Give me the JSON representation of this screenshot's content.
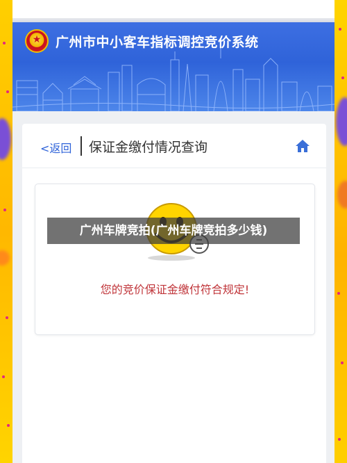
{
  "banner": {
    "system_title": "广州市中小客车指标调控竞价系统",
    "emblem": "guangzhou-emblem-icon"
  },
  "header": {
    "back_label": "<返回",
    "page_title": "保证金缴付情况查询",
    "home_icon": "home-icon"
  },
  "result": {
    "icon": "smiley-thumbs-up-icon",
    "message": "您的竞价保证金缴付符合规定!"
  },
  "overlay": {
    "caption": "广州车牌竞拍(广州车牌竞拍多少钱)"
  },
  "colors": {
    "brand_blue": "#2f63d9",
    "message_red": "#c0353a",
    "frame_yellow": "#ffd400"
  }
}
